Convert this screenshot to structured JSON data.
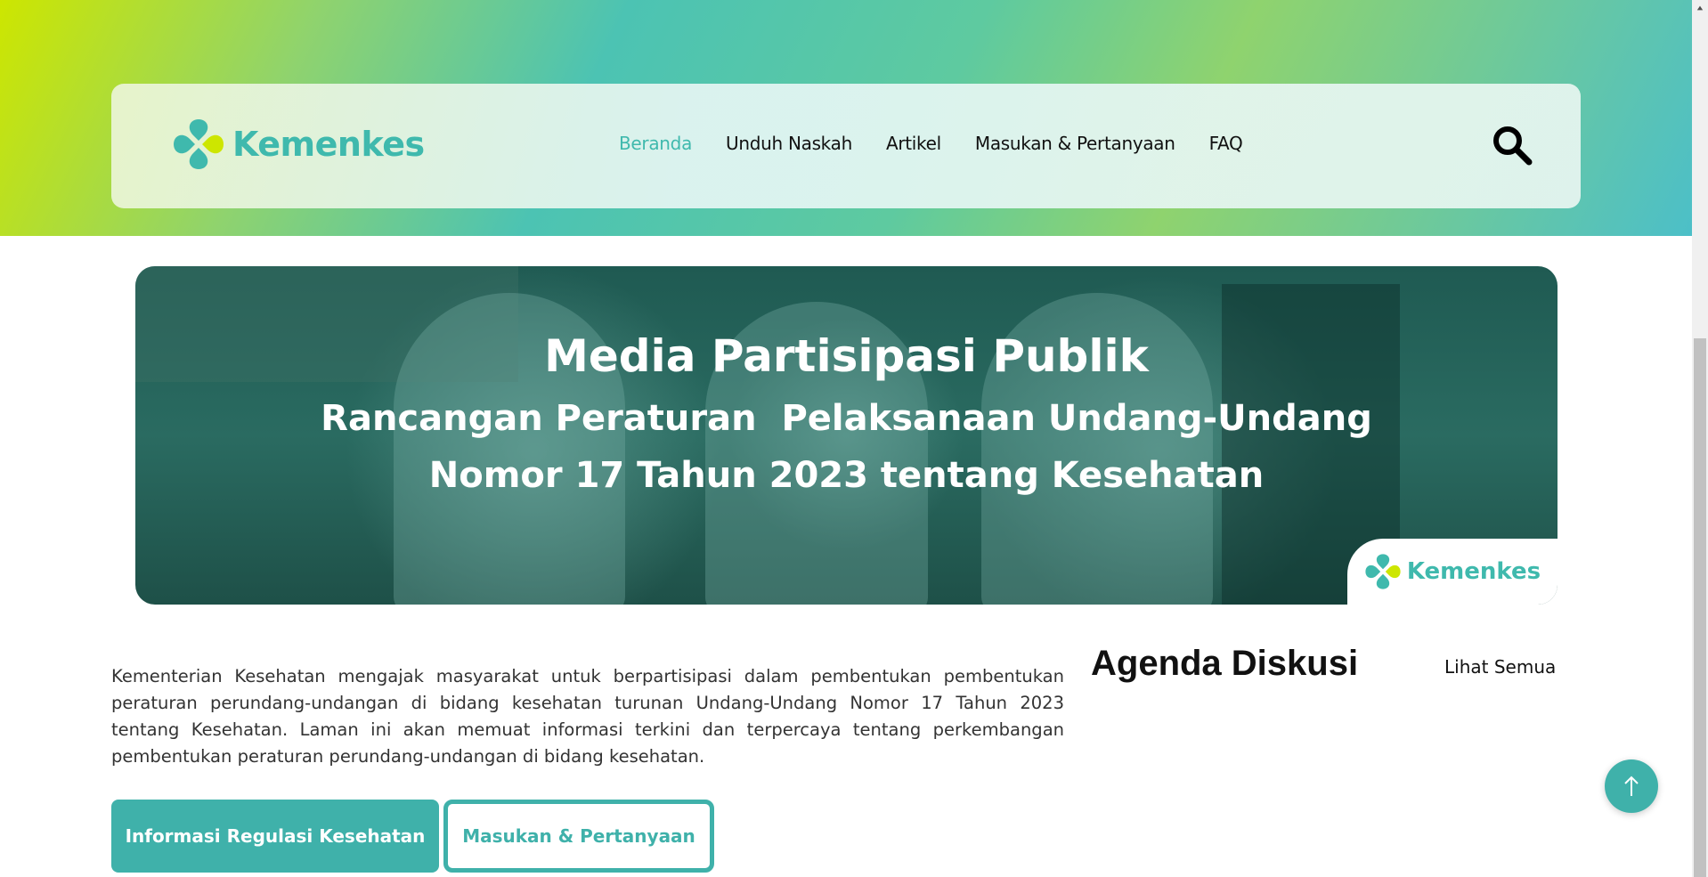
{
  "header": {
    "logo_text": "Kemenkes",
    "nav": [
      {
        "label": "Beranda",
        "active": true
      },
      {
        "label": "Unduh Naskah",
        "active": false
      },
      {
        "label": "Artikel",
        "active": false
      },
      {
        "label": "Masukan & Pertanyaan",
        "active": false
      },
      {
        "label": "FAQ",
        "active": false
      }
    ],
    "search_icon": "search-icon"
  },
  "banner": {
    "title": "Media Partisipasi Publik",
    "subtitle_line1": "Rancangan Peraturan  Pelaksanaan Undang-Undang",
    "subtitle_line2": "Nomor 17 Tahun 2023 tentang Kesehatan",
    "badge_text": "Kemenkes"
  },
  "intro": {
    "text": "Kementerian Kesehatan mengajak masyarakat untuk berpartisipasi dalam pembentukan pembentukan peraturan perundang-undangan di bidang kesehatan turunan Undang-Undang Nomor 17 Tahun 2023 tentang Kesehatan. Laman ini akan memuat informasi terkini dan terpercaya tentang perkembangan pembentukan peraturan perundang-undangan di bidang kesehatan."
  },
  "actions": {
    "primary_label": "Informasi Regulasi Kesehatan",
    "secondary_label": "Masukan & Pertanyaan"
  },
  "agenda": {
    "title": "Agenda Diskusi",
    "view_all": "Lihat Semua"
  },
  "colors": {
    "accent": "#3fb1aa",
    "logo_green": "#cde600",
    "banner_dark": "#1f5a52"
  },
  "icons": {
    "back_to_top": "arrow-up-icon",
    "logo_mark": "kemenkes-logo-icon"
  }
}
